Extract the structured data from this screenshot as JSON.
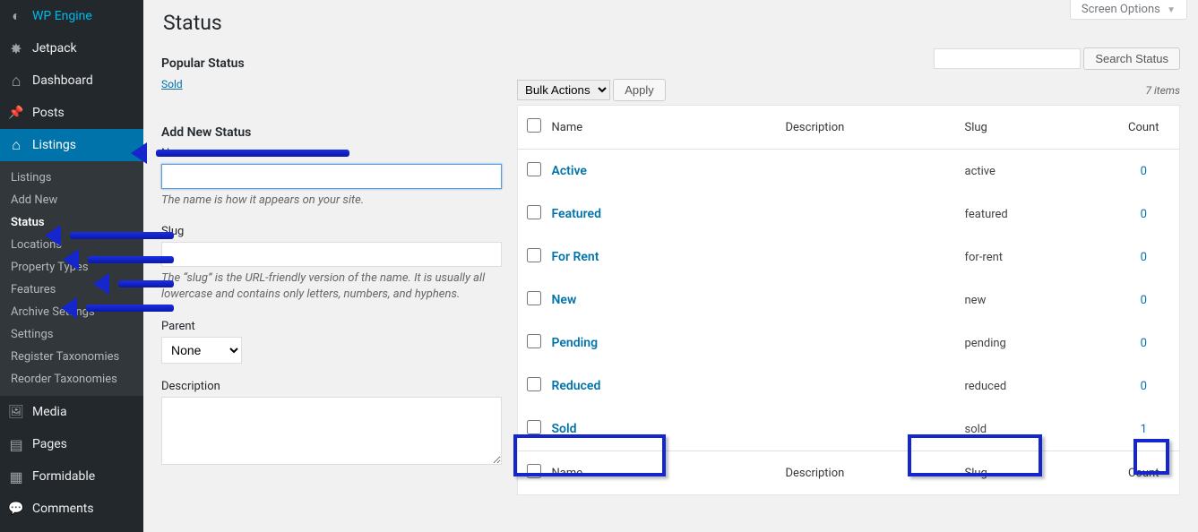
{
  "screen_options_label": "Screen Options",
  "sidebar": {
    "items": [
      {
        "label": "WP Engine",
        "icon": "wpe"
      },
      {
        "label": "Jetpack",
        "icon": "jet"
      },
      {
        "label": "Dashboard",
        "icon": "dash"
      },
      {
        "label": "Posts",
        "icon": "posts"
      },
      {
        "label": "Listings",
        "icon": "home",
        "current": true
      },
      {
        "label": "Media",
        "icon": "media"
      },
      {
        "label": "Pages",
        "icon": "pages"
      },
      {
        "label": "Formidable",
        "icon": "form"
      },
      {
        "label": "Comments",
        "icon": "comments"
      }
    ],
    "submenu": [
      {
        "label": "Listings"
      },
      {
        "label": "Add New"
      },
      {
        "label": "Status",
        "current": true
      },
      {
        "label": "Locations"
      },
      {
        "label": "Property Types"
      },
      {
        "label": "Features"
      },
      {
        "label": "Archive Settings"
      },
      {
        "label": "Settings"
      },
      {
        "label": "Register Taxonomies"
      },
      {
        "label": "Reorder Taxonomies"
      }
    ]
  },
  "page": {
    "title": "Status",
    "popular_heading": "Popular Status",
    "popular_tag": "Sold",
    "add_heading": "Add New Status"
  },
  "form": {
    "name_label": "Name",
    "name_help": "The name is how it appears on your site.",
    "slug_label": "Slug",
    "slug_help": "The “slug” is the URL-friendly version of the name. It is usually all lowercase and contains only letters, numbers, and hyphens.",
    "parent_label": "Parent",
    "parent_value": "None",
    "description_label": "Description"
  },
  "search": {
    "button": "Search Status"
  },
  "bulk": {
    "select_label": "Bulk Actions",
    "apply": "Apply"
  },
  "items_count_label": "7 items",
  "columns": {
    "name": "Name",
    "desc": "Description",
    "slug": "Slug",
    "count": "Count"
  },
  "rows": [
    {
      "name": "Active",
      "desc": "",
      "slug": "active",
      "count": "0"
    },
    {
      "name": "Featured",
      "desc": "",
      "slug": "featured",
      "count": "0"
    },
    {
      "name": "For Rent",
      "desc": "",
      "slug": "for-rent",
      "count": "0"
    },
    {
      "name": "New",
      "desc": "",
      "slug": "new",
      "count": "0"
    },
    {
      "name": "Pending",
      "desc": "",
      "slug": "pending",
      "count": "0"
    },
    {
      "name": "Reduced",
      "desc": "",
      "slug": "reduced",
      "count": "0"
    },
    {
      "name": "Sold",
      "desc": "",
      "slug": "sold",
      "count": "1"
    }
  ]
}
